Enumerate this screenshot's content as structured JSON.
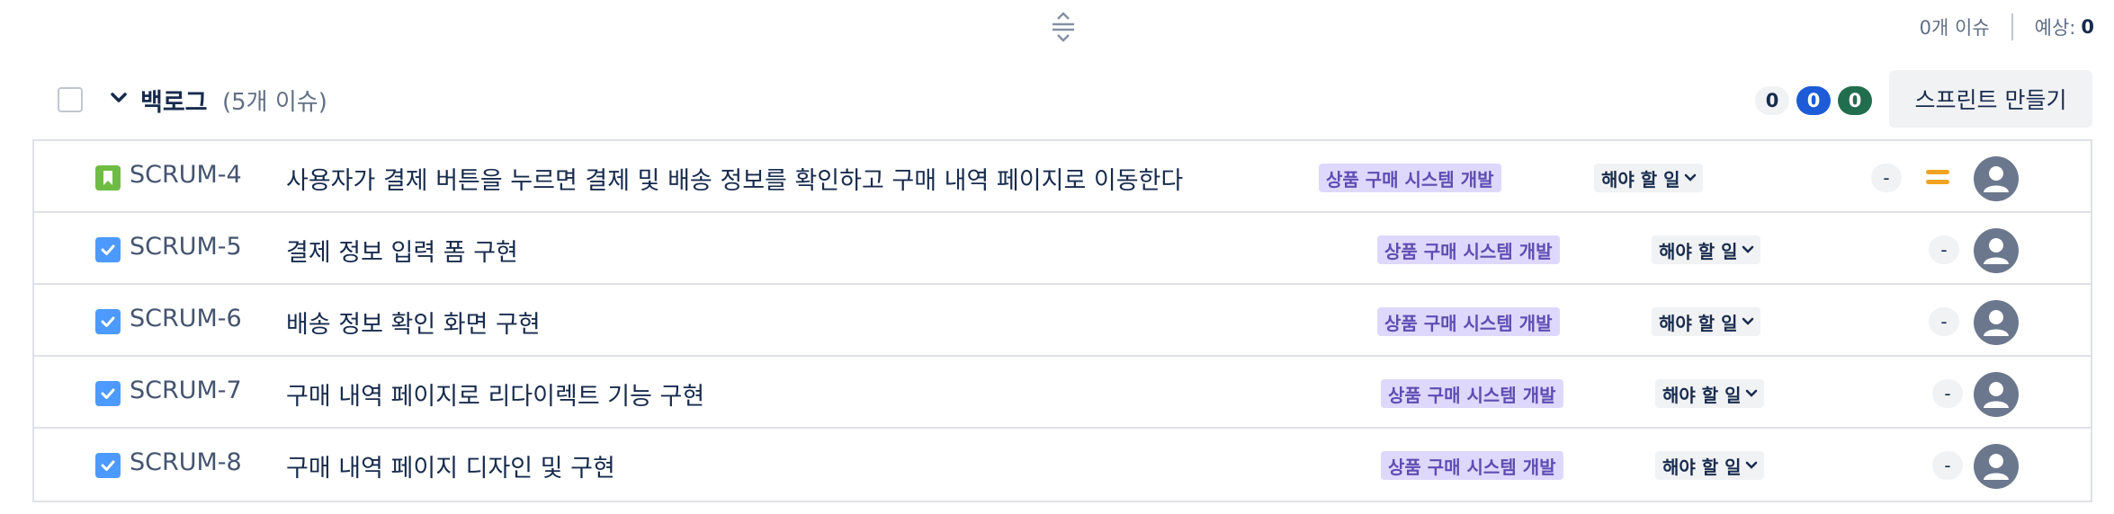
{
  "top_stats": {
    "issue_count": "0개 이슈",
    "estimate_label": "예상:",
    "estimate_value": "0"
  },
  "backlog": {
    "title": "백로그",
    "count": "(5개 이슈)",
    "counters": {
      "todo": "0",
      "in_progress": "0",
      "done": "0"
    },
    "create_sprint_label": "스프린트 만들기"
  },
  "colors": {
    "story_icon": "#6fbc45",
    "task_icon": "#4c9aff",
    "epic_bg": "#dfd8fd",
    "epic_text": "#5e4db2",
    "counter_blue": "#1d5bd8",
    "counter_green": "#216e4e",
    "priority_medium": "#f0a322"
  },
  "issues": [
    {
      "type_icon": "story-bookmark-icon",
      "key": "SCRUM-4",
      "summary": "사용자가 결제 버튼을 누르면 결제 및 배송 정보를 확인하고 구매 내역 페이지로 이동한다",
      "epic": "상품 구매 시스템 개발",
      "status": "해야 할 일",
      "estimate": "-",
      "priority_icon": "priority-medium-icon",
      "avatar_icon": "unassigned-avatar-icon"
    },
    {
      "type_icon": "task-check-icon",
      "key": "SCRUM-5",
      "summary": "결제 정보 입력 폼 구현",
      "epic": "상품 구매 시스템 개발",
      "status": "해야 할 일",
      "estimate": "-",
      "avatar_icon": "unassigned-avatar-icon"
    },
    {
      "type_icon": "task-check-icon",
      "key": "SCRUM-6",
      "summary": "배송 정보 확인 화면 구현",
      "epic": "상품 구매 시스템 개발",
      "status": "해야 할 일",
      "estimate": "-",
      "avatar_icon": "unassigned-avatar-icon"
    },
    {
      "type_icon": "task-check-icon",
      "key": "SCRUM-7",
      "summary": "구매 내역 페이지로 리다이렉트 기능 구현",
      "epic": "상품 구매 시스템 개발",
      "status": "해야 할 일",
      "estimate": "-",
      "avatar_icon": "unassigned-avatar-icon"
    },
    {
      "type_icon": "task-check-icon",
      "key": "SCRUM-8",
      "summary": "구매 내역 페이지 디자인 및 구현",
      "epic": "상품 구매 시스템 개발",
      "status": "해야 할 일",
      "estimate": "-",
      "avatar_icon": "unassigned-avatar-icon"
    }
  ]
}
